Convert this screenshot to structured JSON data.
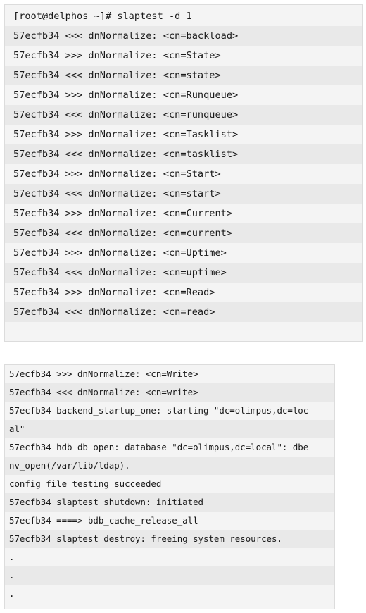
{
  "block1": {
    "lines": [
      "[root@delphos ~]# slaptest -d 1",
      "57ecfb34 <<< dnNormalize: <cn=backload>",
      "57ecfb34 >>> dnNormalize: <cn=State>",
      "57ecfb34 <<< dnNormalize: <cn=state>",
      "57ecfb34 >>> dnNormalize: <cn=Runqueue>",
      "57ecfb34 <<< dnNormalize: <cn=runqueue>",
      "57ecfb34 >>> dnNormalize: <cn=Tasklist>",
      "57ecfb34 <<< dnNormalize: <cn=tasklist>",
      "57ecfb34 >>> dnNormalize: <cn=Start>",
      "57ecfb34 <<< dnNormalize: <cn=start>",
      "57ecfb34 >>> dnNormalize: <cn=Current>",
      "57ecfb34 <<< dnNormalize: <cn=current>",
      "57ecfb34 >>> dnNormalize: <cn=Uptime>",
      "57ecfb34 <<< dnNormalize: <cn=uptime>",
      "57ecfb34 >>> dnNormalize: <cn=Read>",
      "57ecfb34 <<< dnNormalize: <cn=read>"
    ]
  },
  "block2": {
    "lines": [
      "57ecfb34 >>> dnNormalize: <cn=Write>",
      "57ecfb34 <<< dnNormalize: <cn=write>",
      "57ecfb34 backend_startup_one: starting \"dc=olimpus,dc=loc",
      "al\"",
      "57ecfb34 hdb_db_open: database \"dc=olimpus,dc=local\": dbe",
      "nv_open(/var/lib/ldap).",
      "config file testing succeeded",
      "57ecfb34 slaptest shutdown: initiated",
      "57ecfb34 ====> bdb_cache_release_all",
      "57ecfb34 slaptest destroy: freeing system resources.",
      ".",
      ".",
      "."
    ]
  }
}
